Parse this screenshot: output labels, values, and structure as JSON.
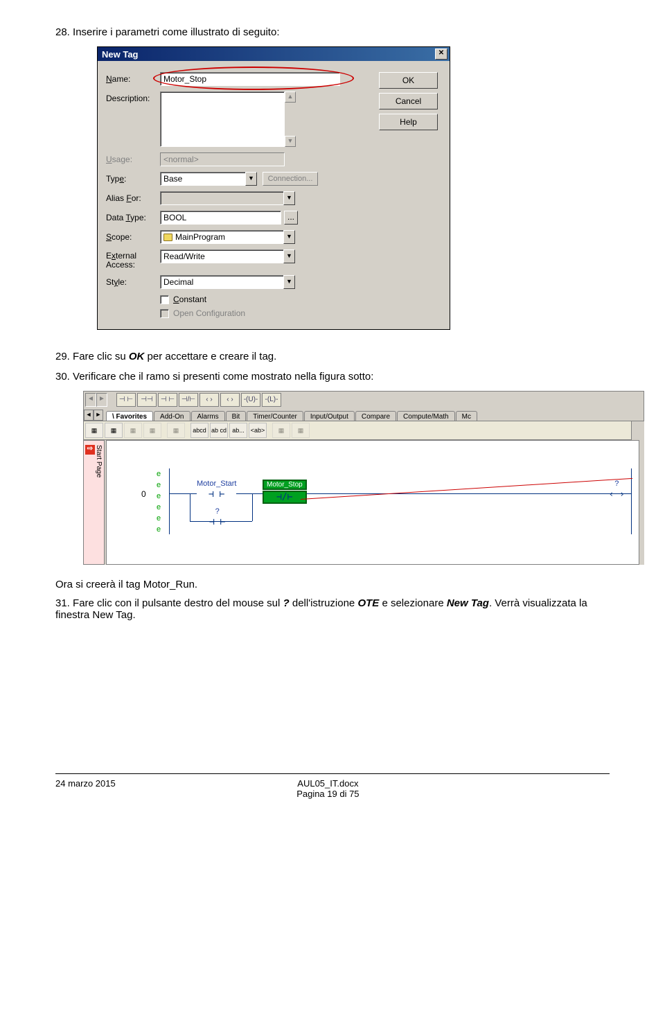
{
  "steps": {
    "s28": {
      "num": "28.",
      "text": "Inserire i parametri come illustrato di seguito:"
    },
    "s29": {
      "num": "29.",
      "prefix": "Fare clic su ",
      "ok": "OK",
      "suffix": " per accettare e creare il tag."
    },
    "s30": {
      "num": "30.",
      "text": "Verificare che il ramo si presenti come mostrato nella figura sotto:"
    },
    "mid": "Ora si creerà il tag Motor_Run.",
    "s31": {
      "num": "31.",
      "prefix": "Fare clic con il pulsante destro del mouse sul ",
      "q": "?",
      "mid": " dell'istruzione ",
      "ote": "OTE",
      "mid2": " e selezionare ",
      "nt": "New Tag",
      "suffix": ". Verrà visualizzata la finestra New Tag."
    }
  },
  "dialog": {
    "title": "New Tag",
    "labels": {
      "name": "Name:",
      "description": "Description:",
      "usage": "Usage:",
      "type": "Type:",
      "aliasfor": "Alias For:",
      "datatype": "Data Type:",
      "scope": "Scope:",
      "external": "External Access:",
      "style": "Style:",
      "constant": "Constant",
      "opencfg": "Open Configuration"
    },
    "values": {
      "name": "Motor_Stop",
      "usage": "<normal>",
      "type": "Base",
      "datatype": "BOOL",
      "scope": "MainProgram",
      "external": "Read/Write",
      "style": "Decimal"
    },
    "buttons": {
      "ok": "OK",
      "cancel": "Cancel",
      "help": "Help",
      "connection": "Connection..."
    }
  },
  "editor": {
    "tabs": [
      "Favorites",
      "Add-On",
      "Alarms",
      "Bit",
      "Timer/Counter",
      "Input/Output",
      "Compare",
      "Compute/Math",
      "Mc"
    ],
    "tb1": [
      "⊣ ⊢",
      "⊣⊣",
      "⊣ ⊢",
      "⊣/⊢",
      "‹ ›",
      "‹ ›",
      "-(U)-",
      "-(L)-"
    ],
    "tb2": [
      "abcd",
      "ab cd",
      "ab...",
      "<ab>"
    ],
    "startpage": "Start Page",
    "rung": "0",
    "motor_start": "Motor_Start",
    "motor_stop": "Motor_Stop",
    "question": "?",
    "eflags": "e\ne\ne\ne\ne\ne"
  },
  "footer": {
    "date": "24 marzo 2015",
    "file": "AUL05_IT.docx",
    "page": "Pagina 19 di 75"
  }
}
